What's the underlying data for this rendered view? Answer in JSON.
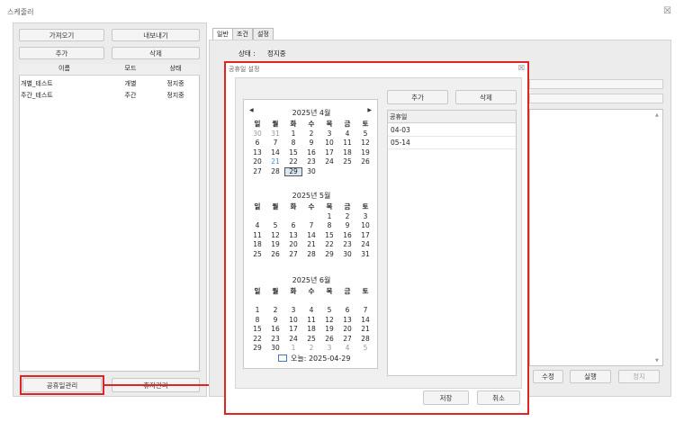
{
  "window": {
    "title": "스케줄러",
    "close_glyph": "☒"
  },
  "left": {
    "buttons": {
      "import": "가져오기",
      "export": "내보내기",
      "add": "추가",
      "delete": "삭제"
    },
    "table": {
      "headers": [
        "이름",
        "모드",
        "상태"
      ],
      "rows": [
        [
          "개별_테스트",
          "개별",
          "정지중"
        ],
        [
          "주간_테스트",
          "주간",
          "정지중"
        ]
      ]
    },
    "bottom": {
      "holiday_mgmt": "공휴일관리",
      "schedule_mgmt": "휴자관리"
    }
  },
  "right": {
    "tabs": [
      "일반",
      "조건",
      "설정"
    ],
    "status_label": "상태 :",
    "status_value": "정지중",
    "bottom_buttons": {
      "edit": "수정",
      "run": "실행",
      "stop": "정지"
    }
  },
  "dialog": {
    "title": "공휴일 설정",
    "close_glyph": "☒",
    "add": "추가",
    "delete": "삭제",
    "list_header": "공휴일",
    "holidays": [
      "04-03",
      "05-14"
    ],
    "save": "저장",
    "cancel": "취소",
    "today": "오늘: 2025-04-29",
    "weekdays": [
      "일",
      "월",
      "화",
      "수",
      "목",
      "금",
      "토"
    ],
    "months": [
      {
        "title": "2025년 4월",
        "weeks": [
          [
            "30",
            "31",
            "1",
            "2",
            "3",
            "4",
            "5"
          ],
          [
            "6",
            "7",
            "8",
            "9",
            "10",
            "11",
            "12"
          ],
          [
            "13",
            "14",
            "15",
            "16",
            "17",
            "18",
            "19"
          ],
          [
            "20",
            "21",
            "22",
            "23",
            "24",
            "25",
            "26"
          ],
          [
            "27",
            "28",
            "29",
            "30",
            "",
            "",
            ""
          ]
        ]
      },
      {
        "title": "2025년 5월",
        "weeks": [
          [
            "",
            "",
            "",
            "",
            "1",
            "2",
            "3"
          ],
          [
            "4",
            "5",
            "6",
            "7",
            "8",
            "9",
            "10"
          ],
          [
            "11",
            "12",
            "13",
            "14",
            "15",
            "16",
            "17"
          ],
          [
            "18",
            "19",
            "20",
            "21",
            "22",
            "23",
            "24"
          ],
          [
            "25",
            "26",
            "27",
            "28",
            "29",
            "30",
            "31"
          ]
        ]
      },
      {
        "title": "2025년 6월",
        "weeks": [
          [
            "",
            "",
            "",
            "",
            "",
            "",
            ""
          ],
          [
            "1",
            "2",
            "3",
            "4",
            "5",
            "6",
            "7"
          ],
          [
            "8",
            "9",
            "10",
            "11",
            "12",
            "13",
            "14"
          ],
          [
            "15",
            "16",
            "17",
            "18",
            "19",
            "20",
            "21"
          ],
          [
            "22",
            "23",
            "24",
            "25",
            "26",
            "27",
            "28"
          ],
          [
            "29",
            "30",
            "1",
            "2",
            "3",
            "4",
            "5"
          ]
        ]
      }
    ]
  },
  "colors": {
    "annotation_red": "#e02424",
    "highlight_blue": "#4a90c9"
  }
}
